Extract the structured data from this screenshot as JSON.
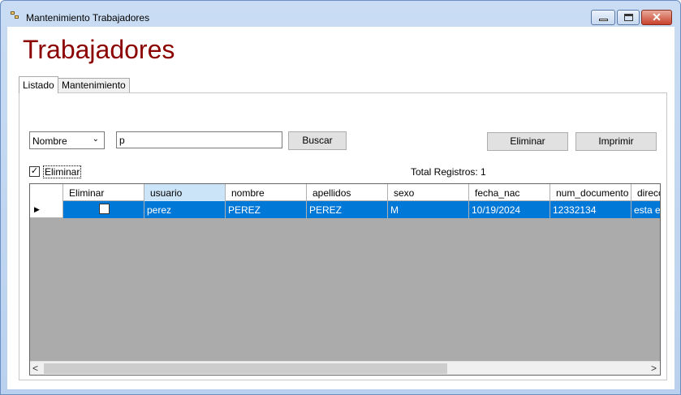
{
  "window": {
    "title": "Mantenimiento Trabajadores",
    "close_glyph": "✕"
  },
  "page": {
    "title": "Trabajadores"
  },
  "tabs": [
    {
      "label": "Listado",
      "active": true
    },
    {
      "label": "Mantenimiento",
      "active": false
    }
  ],
  "search": {
    "field_selected": "Nombre",
    "query_value": "p",
    "buscar_label": "Buscar"
  },
  "actions": {
    "eliminar_label": "Eliminar",
    "imprimir_label": "Imprimir"
  },
  "eliminar_checkbox": {
    "label": "Eliminar",
    "checked": true,
    "check_glyph": "✓"
  },
  "total_registros": "Total Registros: 1",
  "grid": {
    "columns": [
      "Eliminar",
      "usuario",
      "nombre",
      "apellidos",
      "sexo",
      "fecha_nac",
      "num_documento",
      "direcc"
    ],
    "rows": [
      {
        "eliminar": false,
        "usuario": "perez",
        "nombre": "PEREZ",
        "apellidos": "PEREZ",
        "sexo": "M",
        "fecha_nac": "10/19/2024",
        "num_documento": "12332134",
        "direccion": "esta es"
      }
    ],
    "current_row_glyph": "▶",
    "scroll_left_glyph": "<",
    "scroll_right_glyph": ">"
  },
  "colors": {
    "title": "#8b0000",
    "selection": "#0078d7",
    "grid_background": "#ababab",
    "sorted_header": "#cce4f7"
  }
}
